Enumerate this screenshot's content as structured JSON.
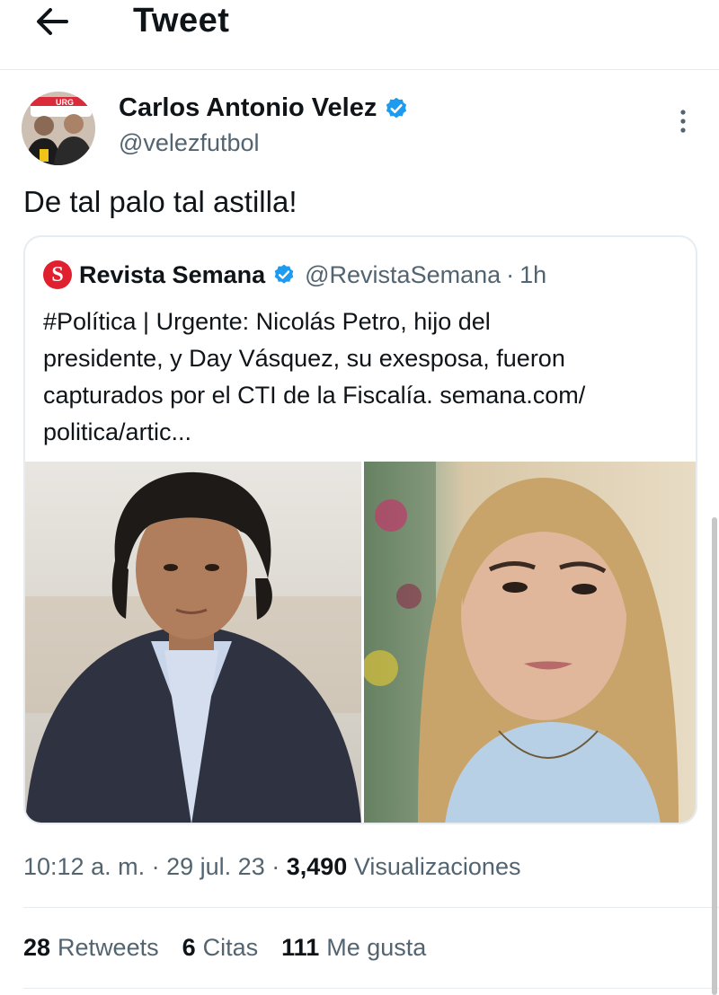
{
  "header": {
    "title": "Tweet",
    "back_icon": "arrow-left-icon"
  },
  "author": {
    "name": "Carlos Antonio Velez",
    "handle": "@velezfutbol",
    "verified": true,
    "more_icon": "more-vertical-icon",
    "avatar_banner_text": "URG"
  },
  "tweet": {
    "text": "De tal palo tal astilla!"
  },
  "quote": {
    "logo_letter": "S",
    "name": "Revista Semana",
    "handle": "@RevistaSemana",
    "separator": "·",
    "time": "1h",
    "text_lines": [
      "#Política | Urgente: Nicolás Petro, hijo del",
      "presidente, y Day Vásquez, su exesposa, fueron",
      "capturados por el CTI de la Fiscalía. semana.com/",
      "politica/artic..."
    ]
  },
  "meta": {
    "time": "10:12 a. m.",
    "sep1": "·",
    "date": "29 jul. 23",
    "sep2": "·",
    "views": "3,490",
    "views_label": "Visualizaciones"
  },
  "stats": {
    "retweets": "28",
    "retweets_label": "Retweets",
    "quotes": "6",
    "quotes_label": "Citas",
    "likes": "111",
    "likes_label": "Me gusta"
  },
  "colors": {
    "verified": "#1d9bf0",
    "secondary_text": "#536471",
    "semana_red": "#e0202e",
    "divider": "#e6ecf0"
  }
}
